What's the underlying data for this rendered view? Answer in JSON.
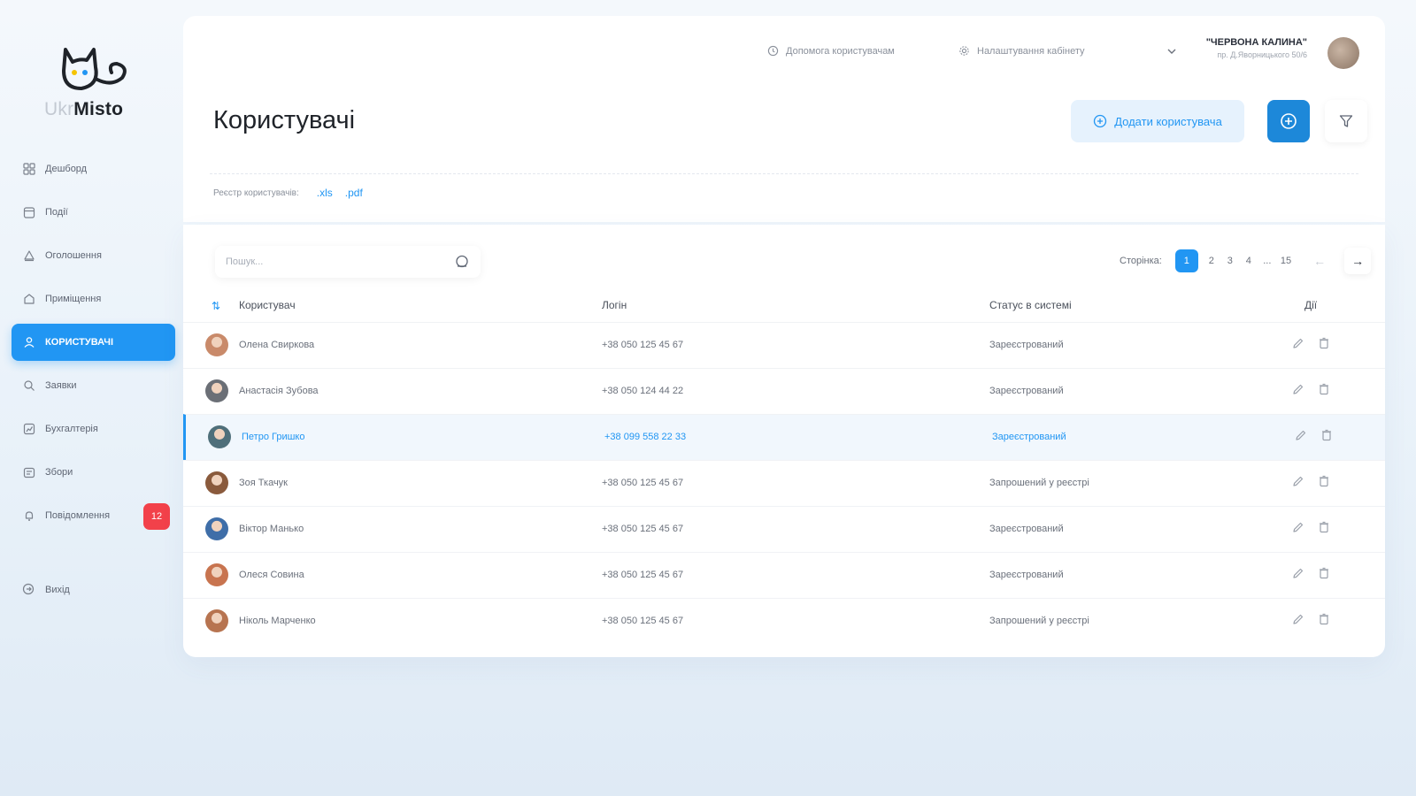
{
  "app": {
    "logo_prefix": "Ukr",
    "logo_suffix": "Misto"
  },
  "sidebar": {
    "items": [
      {
        "label": "Дешборд",
        "icon": "dashboard-icon"
      },
      {
        "label": "Події",
        "icon": "events-icon"
      },
      {
        "label": "Оголошення",
        "icon": "announcements-icon"
      },
      {
        "label": "Приміщення",
        "icon": "premises-icon"
      },
      {
        "label": "КОРИСТУВАЧІ",
        "icon": "users-icon",
        "active": true
      },
      {
        "label": "Заявки",
        "icon": "requests-icon"
      },
      {
        "label": "Бухгалтерія",
        "icon": "accounting-icon"
      },
      {
        "label": "Збори",
        "icon": "meetings-icon"
      },
      {
        "label": "Повідомлення",
        "icon": "notifications-icon",
        "badge": "12"
      }
    ],
    "exit_label": "Вихід"
  },
  "topbar": {
    "help_label": "Допомога користувачам",
    "settings_label": "Налаштування кабінету",
    "user_name": "\"ЧЕРВОНА КАЛИНА\"",
    "user_address": "пр. Д.Яворницького 50/6"
  },
  "page": {
    "title": "Користувачі",
    "add_button_label": "Додати користувача",
    "registry_label": "Реєстр користувачів:",
    "export_xls": ".xls",
    "export_pdf": ".pdf"
  },
  "search": {
    "placeholder": "Пошук..."
  },
  "pagination": {
    "label": "Сторінка:",
    "pages": [
      "1",
      "2",
      "3",
      "4",
      "...",
      "15"
    ],
    "current": "1",
    "prev": "←",
    "next": "→"
  },
  "table": {
    "columns": {
      "user": "Користувач",
      "login": "Логін",
      "status": "Статус в системі",
      "actions": "Дії"
    },
    "rows": [
      {
        "name": "Олена Свиркова",
        "login": "+38 050 125 45 67",
        "status": "Зареєстрований",
        "avatar": "#c98a6a"
      },
      {
        "name": "Анастасія Зубова",
        "login": "+38 050 124 44 22",
        "status": "Зареєстрований",
        "avatar": "#6b6f76"
      },
      {
        "name": "Петро Гришко",
        "login": "+38 099 558 22 33",
        "status": "Зареєстрований",
        "avatar": "#4f6f7a",
        "selected": true
      },
      {
        "name": "Зоя Ткачук",
        "login": "+38 050 125 45 67",
        "status": "Запрошений у реєстрі",
        "avatar": "#8a5a3c"
      },
      {
        "name": "Віктор Манько",
        "login": "+38 050 125 45 67",
        "status": "Зареєстрований",
        "avatar": "#3f6ea8"
      },
      {
        "name": "Олеся Совина",
        "login": "+38 050 125 45 67",
        "status": "Зареєстрований",
        "avatar": "#c8744f"
      },
      {
        "name": "Ніколь Марченко",
        "login": "+38 050 125 45 67",
        "status": "Запрошений у реєстрі",
        "avatar": "#b77450"
      }
    ]
  },
  "colors": {
    "accent": "#2196f3",
    "badge": "#f2414a"
  }
}
